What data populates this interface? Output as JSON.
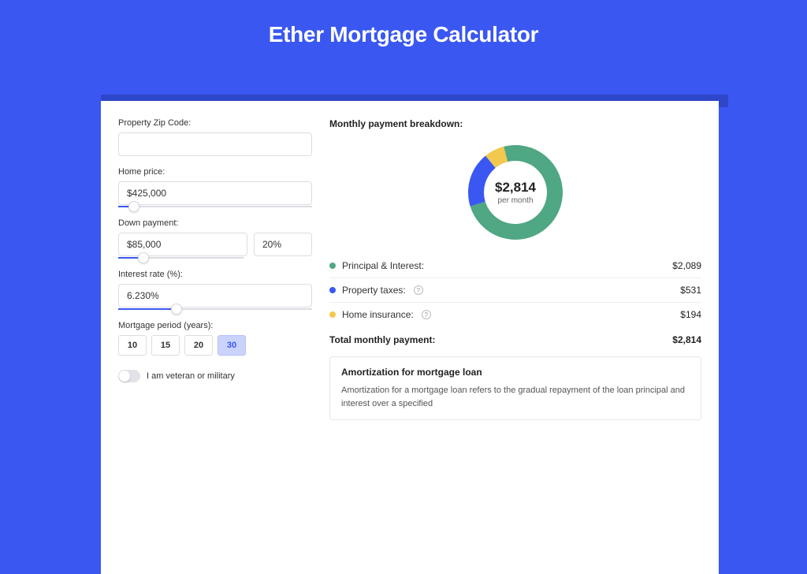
{
  "title": "Ether Mortgage Calculator",
  "colors": {
    "principal": "#4fa783",
    "taxes": "#3a57f2",
    "insurance": "#f2c84f"
  },
  "form": {
    "zip_label": "Property Zip Code:",
    "zip_value": "",
    "home_price_label": "Home price:",
    "home_price_value": "$425,000",
    "home_price_slider_pct": 8,
    "down_payment_label": "Down payment:",
    "down_payment_value": "$85,000",
    "down_payment_pct_value": "20%",
    "down_payment_slider_pct": 20,
    "interest_label": "Interest rate (%):",
    "interest_value": "6.230%",
    "interest_slider_pct": 30,
    "period_label": "Mortgage period (years):",
    "periods": [
      "10",
      "15",
      "20",
      "30"
    ],
    "period_active_index": 3,
    "veteran_label": "I am veteran or military",
    "veteran_on": false
  },
  "breakdown": {
    "section_title": "Monthly payment breakdown:",
    "center_amount": "$2,814",
    "center_sub": "per month",
    "items": [
      {
        "label": "Principal & Interest:",
        "value": "$2,089",
        "color_key": "principal",
        "info": false
      },
      {
        "label": "Property taxes:",
        "value": "$531",
        "color_key": "taxes",
        "info": true
      },
      {
        "label": "Home insurance:",
        "value": "$194",
        "color_key": "insurance",
        "info": true
      }
    ],
    "total_label": "Total monthly payment:",
    "total_value": "$2,814"
  },
  "amortization": {
    "title": "Amortization for mortgage loan",
    "text": "Amortization for a mortgage loan refers to the gradual repayment of the loan principal and interest over a specified"
  },
  "chart_data": {
    "type": "pie",
    "title": "Monthly payment breakdown",
    "series": [
      {
        "name": "Principal & Interest",
        "value": 2089,
        "color": "#4fa783"
      },
      {
        "name": "Property taxes",
        "value": 531,
        "color": "#3a57f2"
      },
      {
        "name": "Home insurance",
        "value": 194,
        "color": "#f2c84f"
      }
    ],
    "total": 2814,
    "center_label": "$2,814 per month"
  }
}
